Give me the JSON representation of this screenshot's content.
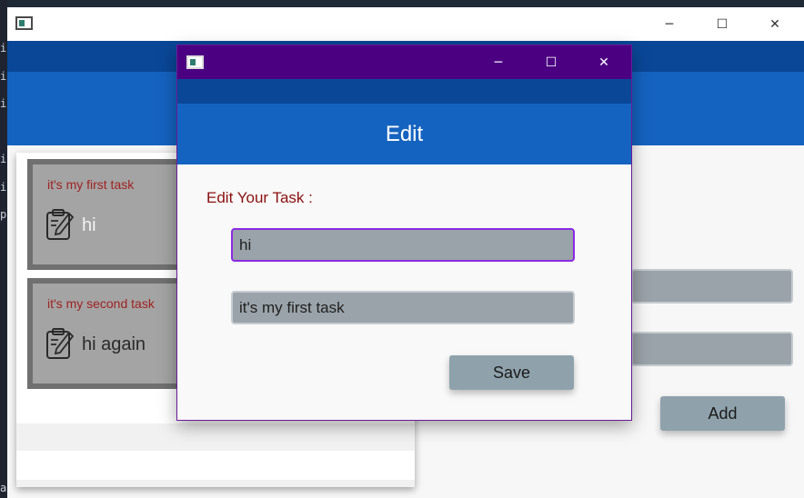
{
  "terminal": {
    "glyphs": [
      "i",
      "i",
      "i",
      "i",
      "i",
      "p",
      "a"
    ]
  },
  "main_window": {
    "controls": {
      "minimize": "─",
      "maximize": "☐",
      "close": "✕"
    },
    "tasks": [
      {
        "description": "it's my first task",
        "title": "hi"
      },
      {
        "description": "it's my second task",
        "title": "hi again"
      }
    ],
    "add_label": "Add"
  },
  "dialog": {
    "controls": {
      "minimize": "─",
      "maximize": "☐",
      "close": "✕"
    },
    "header": "Edit",
    "prompt": "Edit Your Task :",
    "title_value": "hi",
    "description_value": "it's my first task",
    "save_label": "Save"
  },
  "colors": {
    "dialog_titlebar": "#4b0082",
    "nav": "#0a4797",
    "header": "#1563c0",
    "button": "#8fa2ac",
    "field": "#9aa3a9",
    "description_text": "#a02222"
  },
  "icons": {
    "task": "clipboard-edit-icon",
    "window": "app-window-icon"
  }
}
